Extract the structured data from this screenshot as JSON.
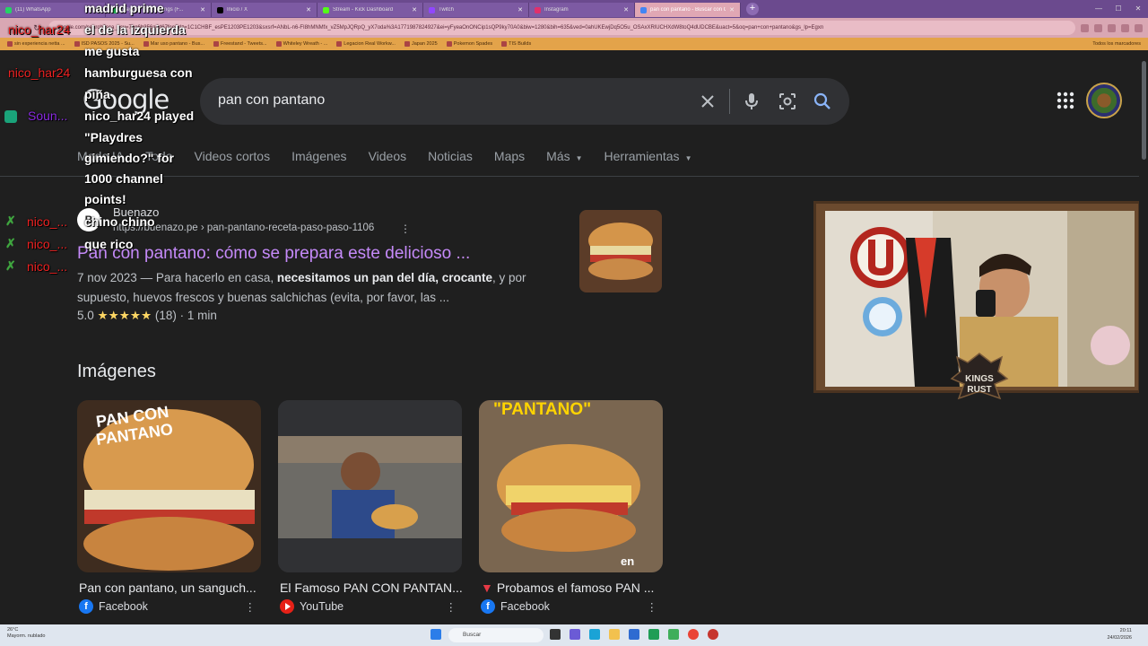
{
  "browser": {
    "tabs": [
      {
        "label": "(11) WhatsApp",
        "color": "#25d366"
      },
      {
        "label": "Playlist - Maps Songs (F...",
        "color": "#1db954"
      },
      {
        "label": "Inicio / X",
        "color": "#000000"
      },
      {
        "label": "Stream - Kick Dashboard",
        "color": "#53fc18"
      },
      {
        "label": "Twitch",
        "color": "#9146ff"
      },
      {
        "label": "Instagram",
        "color": "#e1306c"
      },
      {
        "label": "pan con pantano - Buscar con G...",
        "color": "#4285f4"
      }
    ],
    "address_url": "google.com/search?sca_esv=7be6b356a4d67fce&rlz=1C1CHBF_esPE1203PE1203&sxsrf=ANbL-n6-FI8hMNMfx_vZ5MpJQRpQ_yX7oda%3A1771987824927&ei=yFyeaOnONCip1sQP9ky70A0&biw=1280&bih=635&ved=0ahUKEwjDq5O5u_OSAxXRlUCHXdW8toQ4dUDCBE&uact=5&oq=pan+con+pantano&gs_lp=Egxn",
    "bookmarks": [
      "sin experiencia netta ...",
      "ISD PASOS 2025 - Su...",
      "Mar uso pantano - Bus...",
      "Freestand - Tweets...",
      "Whiteley Wreath - ...",
      "Legacion Real Workw...",
      "Japan 2025",
      "Pokemon Spades",
      "TIS Builds"
    ],
    "bookmarks_other": "Todos los marcadores"
  },
  "search": {
    "logo": "Google",
    "query": "pan con pantano",
    "tabs": [
      "Modo IA",
      "Todo",
      "Videos cortos",
      "Imágenes",
      "Videos",
      "Noticias",
      "Maps",
      "Más",
      "Herramientas"
    ]
  },
  "result": {
    "site_name": "Buenazo",
    "url": "https://buenazo.pe › pan-pantano-receta-paso-paso-1106",
    "title": "Pan con pantano: cómo se prepara este delicioso ...",
    "snippet_date": "7 nov 2023",
    "snippet_pre": " — Para hacerlo en casa, ",
    "snippet_bold": "necesitamos un pan del día, crocante",
    "snippet_post": ", y por supuesto, huevos frescos y buenas salchichas (evita, por favor, las ...",
    "rating": "5.0",
    "stars": "★★★★★",
    "rating_tail": "(18) · 1 min"
  },
  "images": {
    "heading": "Imágenes",
    "cards": [
      {
        "caption": "Pan con pantano, un sanguch...",
        "source": "Facebook",
        "overlay": "PAN CON PANTANO"
      },
      {
        "caption": "El Famoso PAN CON PANTAN...",
        "source": "YouTube",
        "overlay": ""
      },
      {
        "caption": "Probamos el famoso PAN ...",
        "source": "Facebook",
        "overlay": "\"PANTANO\"",
        "badge": "en"
      }
    ]
  },
  "chat": {
    "line1": "madrid prime",
    "user1": "nico_har24",
    "line2": "el de la izquierda",
    "line3": "me gusta",
    "user2": "nico_har24",
    "line4": "hamburguesa con",
    "line5": "piña",
    "sound_user": "Soun...",
    "line6": "nico_har24 played",
    "line7": "\"Playdres",
    "line8": "gimiendo?\" for",
    "line9": "1000 channel",
    "line10": "points!",
    "line11": "chino chino",
    "line12": "que rico",
    "short_users": [
      "nico_...",
      "nico_...",
      "nico_..."
    ]
  },
  "webcam": {
    "badge_text": "KINGS RUST"
  },
  "taskbar": {
    "weather_temp": "26°C",
    "weather_desc": "Mayorm. nublado",
    "search_placeholder": "Buscar",
    "time": "20:11",
    "date": "24/02/2026"
  }
}
